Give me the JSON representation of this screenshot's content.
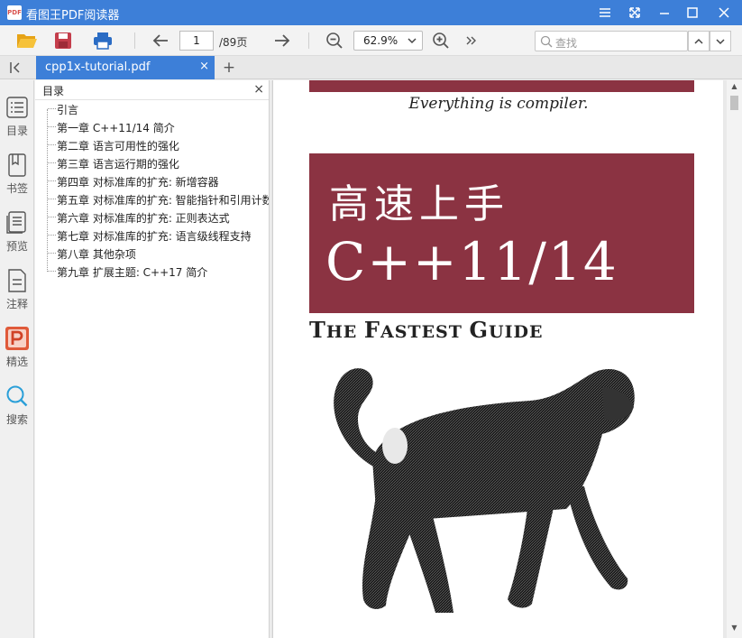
{
  "app": {
    "title": "看图王PDF阅读器",
    "icon_text": "PDF",
    "window_buttons": [
      "menu-icon",
      "fullscreen-icon",
      "minimize-icon",
      "maximize-icon",
      "close-icon"
    ]
  },
  "toolbar": {
    "open_icon": "folder-open-icon",
    "save_icon": "save-icon",
    "print_icon": "print-icon",
    "prev_icon": "arrow-left-icon",
    "page_current": "1",
    "page_total": "/89页",
    "next_icon": "arrow-right-icon",
    "zoom_out_icon": "zoom-out-icon",
    "zoom_value": "62.9%",
    "zoom_in_icon": "zoom-in-icon",
    "more_icon": "double-chevron-right-icon",
    "search_placeholder": "查找"
  },
  "tabs": [
    {
      "label": "cpp1x-tutorial.pdf",
      "close": "×",
      "active": true
    }
  ],
  "tab_add": "+",
  "rail": [
    {
      "label": "目录",
      "icon": "list-icon"
    },
    {
      "label": "书签",
      "icon": "bookmark-icon"
    },
    {
      "label": "预览",
      "icon": "pages-icon"
    },
    {
      "label": "注释",
      "icon": "note-icon"
    },
    {
      "label": "精选",
      "icon": "featured-p-icon"
    },
    {
      "label": "搜索",
      "icon": "search-icon"
    }
  ],
  "outline": {
    "title": "目录",
    "close": "×",
    "items": [
      "引言",
      "第一章 C++11/14 简介",
      "第二章 语言可用性的强化",
      "第三章 语言运行期的强化",
      "第四章 对标准库的扩充: 新增容器",
      "第五章 对标准库的扩充: 智能指针和引用计数",
      "第六章 对标准库的扩充: 正则表达式",
      "第七章 对标准库的扩充: 语言级线程支持",
      "第八章 其他杂项",
      "第九章 扩展主题: C++17 简介"
    ]
  },
  "document": {
    "tagline": "Everything is compiler.",
    "title_cn": "高速上手",
    "title_cpp": "C++11/14",
    "subtitle_first_t": "T",
    "subtitle_he": "HE ",
    "subtitle_first_f": "F",
    "subtitle_astest": "ASTEST ",
    "subtitle_first_g": "G",
    "subtitle_uide": "UIDE",
    "accent_color": "#8b3342"
  },
  "colors": {
    "titlebar": "#3d7fd8",
    "tab_active": "#3d7fd8",
    "rail_featured": "#e05a3a",
    "rail_search": "#2a9fd8"
  }
}
